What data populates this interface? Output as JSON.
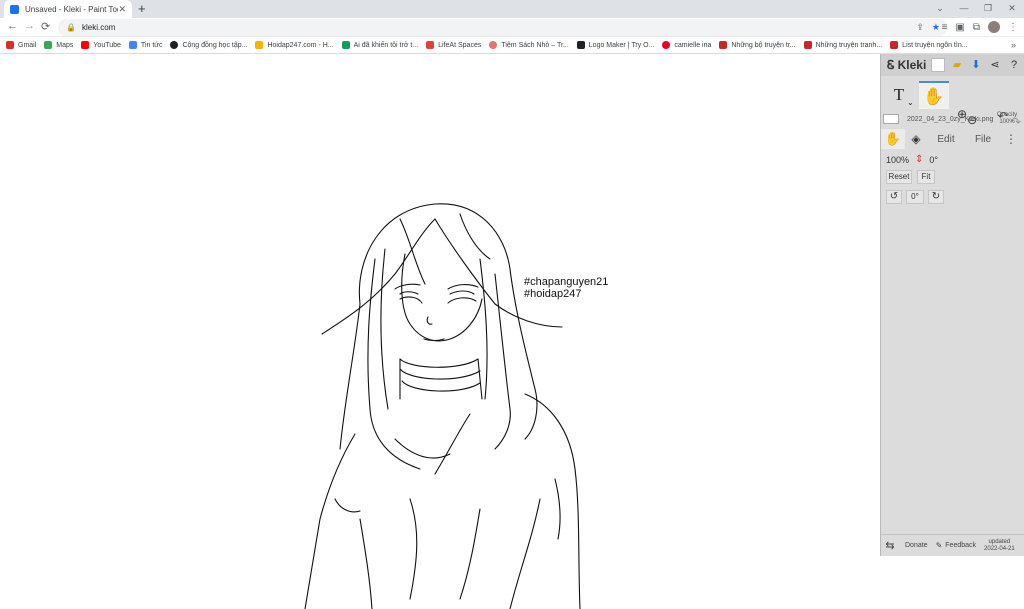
{
  "browser": {
    "tab_title": "Unsaved - Kleki - Paint Tool",
    "tab_close": "✕",
    "new_tab": "+",
    "window_controls": [
      "⌄",
      "—",
      "❐",
      "✕"
    ],
    "url": "kleki.com",
    "nav": {
      "back": "←",
      "forward": "→",
      "reload": "⟳"
    }
  },
  "bookmarks": [
    {
      "label": "Gmail",
      "color": "#d93025"
    },
    {
      "label": "Maps",
      "color": "#34a853"
    },
    {
      "label": "YouTube",
      "color": "#ff0000"
    },
    {
      "label": "Tin tức",
      "color": "#4285f4"
    },
    {
      "label": "Cộng đồng học tập...",
      "color": "#202124"
    },
    {
      "label": "Hoidap247.com - H...",
      "color": "#f4b400"
    },
    {
      "label": "Ai đã khiến tôi trở t...",
      "color": "#0f9d58"
    },
    {
      "label": "LifeAt Spaces",
      "color": "#db4437"
    },
    {
      "label": "Tiệm Sách Nhỏ – Tr...",
      "color": "#e57373"
    },
    {
      "label": "Logo Maker | Try O...",
      "color": "#202124"
    },
    {
      "label": "camielle ina",
      "color": "#e60023"
    },
    {
      "label": "Những bộ truyện tr...",
      "color": "#c62828"
    },
    {
      "label": "Những truyện tranh...",
      "color": "#c62828"
    },
    {
      "label": "List truyện ngôn tìn...",
      "color": "#c62828"
    }
  ],
  "bookmarks_more": "»",
  "canvas": {
    "hashtag_1": "#chapanguyen21",
    "hashtag_2": "#hoidap247"
  },
  "panel": {
    "logo": "Kleki",
    "file_name": "2022_04_23_0zy_Kleki.png",
    "opacity_label": "Opacity",
    "opacity_value": "100%",
    "tabs": {
      "edit": "Edit",
      "file": "File"
    },
    "zoom": "100%",
    "rotation": "0°",
    "reset": "Reset",
    "fit": "Fit",
    "rotate_value": "0°",
    "footer": {
      "donate": "Donate",
      "feedback": "Feedback",
      "updated_label": "updated",
      "updated_date": "2022-04-21"
    }
  }
}
